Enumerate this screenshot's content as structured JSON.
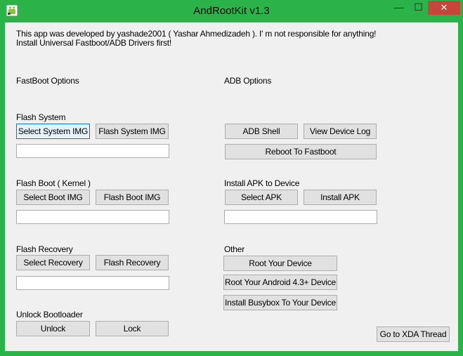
{
  "window": {
    "title": "AndRootKit v1.3",
    "minimize_glyph": "—",
    "maximize_glyph": "☐",
    "close_glyph": "✕"
  },
  "header": {
    "line1": "This app was developed by yashade2001 ( Yashar Ahmedizadeh ). I' m not responsible for anything!",
    "line2": "Install Universal Fastboot/ADB Drivers first!"
  },
  "fastboot": {
    "heading": "FastBoot Options",
    "flash_system": {
      "label": "Flash System",
      "select_button": "Select System IMG",
      "flash_button": "Flash System IMG",
      "path_value": ""
    },
    "flash_boot": {
      "label": "Flash Boot ( Kernel )",
      "select_button": "Select Boot IMG",
      "flash_button": "Flash Boot IMG",
      "path_value": ""
    },
    "flash_recovery": {
      "label": "Flash Recovery",
      "select_button": "Select Recovery",
      "flash_button": "Flash Recovery",
      "path_value": ""
    },
    "unlock_bootloader": {
      "label": "Unlock Bootloader",
      "unlock_button": "Unlock",
      "lock_button": "Lock"
    }
  },
  "adb": {
    "heading": "ADB Options",
    "adb_shell_button": "ADB Shell",
    "view_log_button": "View Device Log",
    "reboot_fastboot_button": "Reboot To Fastboot",
    "install_apk": {
      "label": "Install APK to Device",
      "select_button": "Select APK",
      "install_button": "Install APK",
      "path_value": ""
    },
    "other": {
      "label": "Other",
      "root_button": "Root Your Device",
      "root_43_button": "Root Your Android 4.3+ Device",
      "busybox_button": "Install Busybox To Your Device"
    }
  },
  "xda_button": "Go to XDA Thread",
  "colors": {
    "frame": "#2bb34a",
    "client_bg": "#f0f0f0",
    "close_button": "#c7463b",
    "focus_border": "#0078d7"
  }
}
